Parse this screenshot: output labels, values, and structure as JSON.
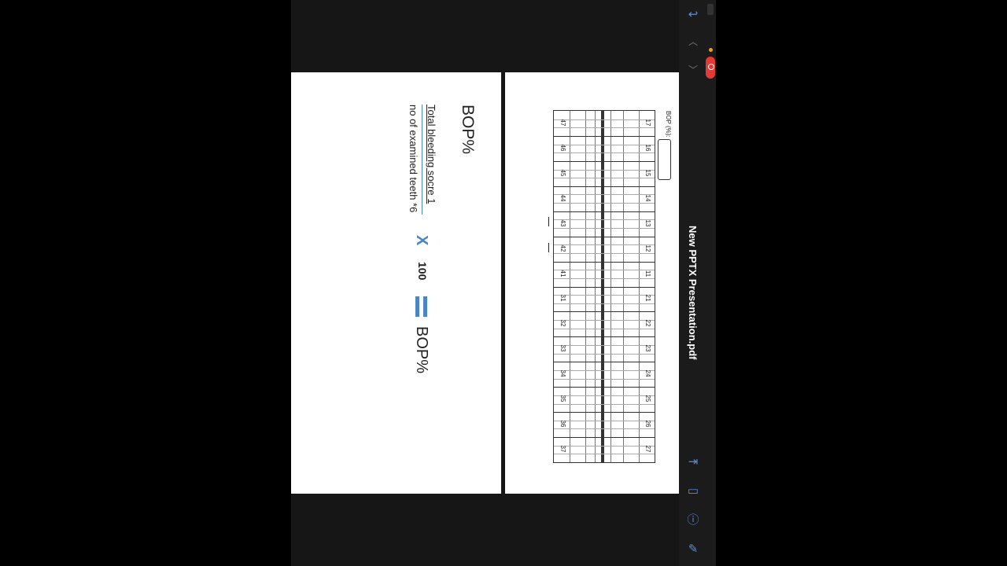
{
  "header": {
    "document_title": "New PPTX Presentation.pdf"
  },
  "toolbar": {
    "icons": [
      "back-icon",
      "chevron-up-icon",
      "chevron-down-icon",
      "export-icon",
      "bookmark-icon",
      "info-icon",
      "annotate-icon"
    ]
  },
  "slide1": {
    "bop_label": "BOP (%):",
    "upper_teeth": [
      "17",
      "16",
      "15",
      "14",
      "13",
      "12",
      "11",
      "21",
      "22",
      "23",
      "24",
      "25",
      "26",
      "27"
    ],
    "lower_teeth": [
      "47",
      "46",
      "45",
      "44",
      "43",
      "42",
      "41",
      "31",
      "32",
      "33",
      "34",
      "35",
      "36",
      "37"
    ]
  },
  "slide2": {
    "title": "BOP%",
    "numerator": "Total bleeding socre",
    "numerator_suffix": " 1",
    "denominator": "no of examined teeth *6",
    "times_symbol": "X",
    "multiplier": "100",
    "result": "BOP%"
  },
  "colors": {
    "accent": "#4a86c5",
    "record": "#e53935",
    "background": "#000000"
  }
}
